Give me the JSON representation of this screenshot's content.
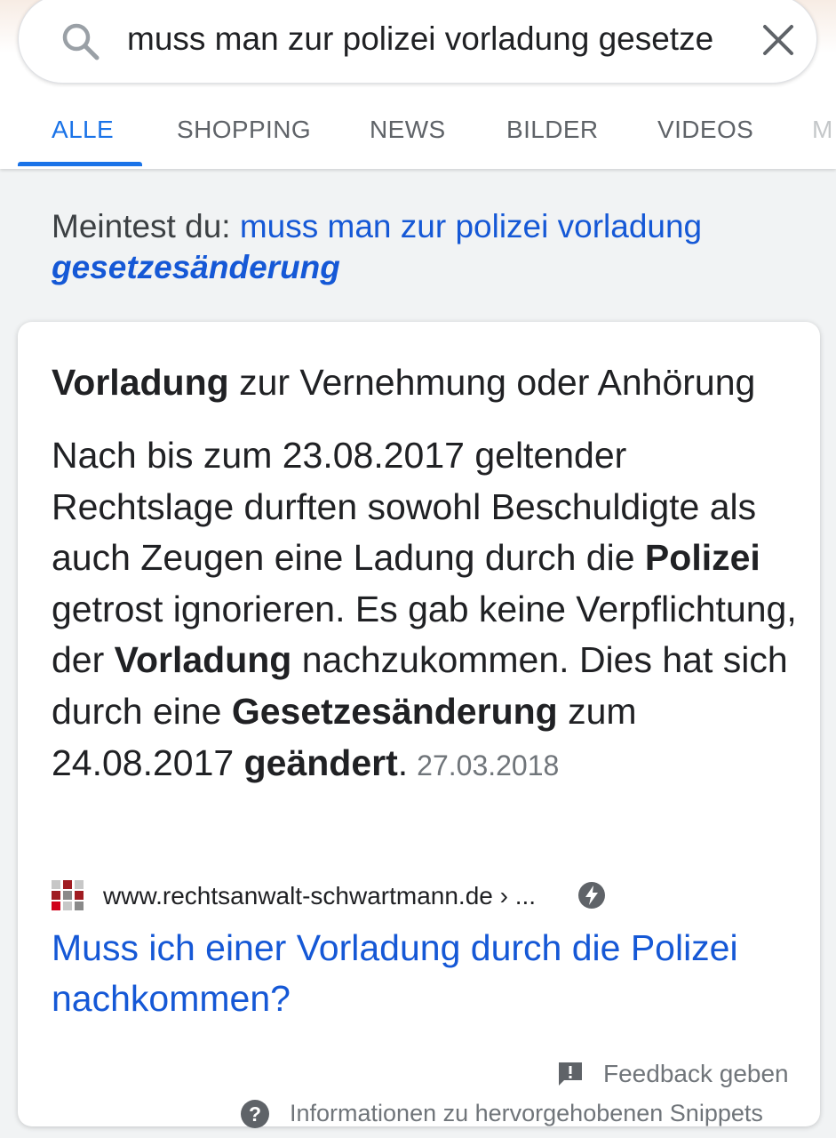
{
  "search": {
    "query": "muss man zur polizei vorladung gesetze",
    "search_icon": "search-icon",
    "clear_icon": "close-icon"
  },
  "tabs": [
    {
      "label": "ALLE",
      "active": true
    },
    {
      "label": "SHOPPING",
      "active": false
    },
    {
      "label": "NEWS",
      "active": false
    },
    {
      "label": "BILDER",
      "active": false
    },
    {
      "label": "VIDEOS",
      "active": false
    },
    {
      "label": "M",
      "active": false
    }
  ],
  "did_you_mean": {
    "prefix": "Meintest du:",
    "link_plain": "muss man zur polizei vorladung",
    "link_corrected": "gesetzesänderung"
  },
  "snippet": {
    "title_bold": "Vorladung",
    "title_rest": " zur Vernehmung oder Anhörung",
    "body": [
      {
        "text": "Nach bis zum 23.08.2017 geltender Rechtslage durften sowohl Beschuldigte als auch Zeugen eine Ladung durch die ",
        "bold": false
      },
      {
        "text": "Polizei",
        "bold": true
      },
      {
        "text": " getrost ignorieren. Es gab keine Verpflichtung, der ",
        "bold": false
      },
      {
        "text": "Vorladung",
        "bold": true
      },
      {
        "text": " nachzukommen. Dies hat sich durch eine ",
        "bold": false
      },
      {
        "text": "Gesetzesänderung",
        "bold": true
      },
      {
        "text": " zum 24.08.2017 ",
        "bold": false
      },
      {
        "text": "geändert",
        "bold": true
      },
      {
        "text": ".",
        "bold": false
      }
    ],
    "date": "27.03.2018",
    "source_url": "www.rechtsanwalt-schwartmann.de › ...",
    "amp_icon": "amp-lightning-icon",
    "result_title": "Muss ich einer Vorladung durch die Polizei nachkommen?",
    "feedback_label": "Feedback geben",
    "info_label": "Informationen zu hervorgehobenen Snippets"
  },
  "colors": {
    "accent": "#1a73e8",
    "link": "#1558d6",
    "muted": "#70757a"
  }
}
